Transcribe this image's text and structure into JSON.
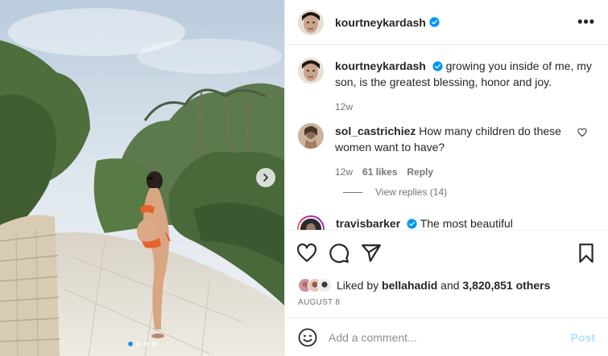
{
  "post": {
    "username": "kourtneykardash",
    "more_label": "•••",
    "caption": {
      "username": "kourtneykardash",
      "text": "growing you inside of me, my son, is the greatest blessing, honor and joy.",
      "age": "12w"
    },
    "comments": [
      {
        "username": "sol_castrichiez",
        "text": "How many children do these women want to have?",
        "age": "12w",
        "likes": "61 likes",
        "reply_label": "Reply",
        "view_replies": "View replies (14)"
      },
      {
        "username": "travisbarker",
        "text": "The most beautiful"
      }
    ],
    "liked_by_prefix": "Liked by",
    "liked_by_user": "bellahadid",
    "liked_by_and": "and",
    "liked_by_others": "3,820,851 others",
    "date": "AUGUST 8",
    "add_comment_placeholder": "Add a comment...",
    "post_label": "Post"
  },
  "colors": {
    "verified": "#0095f6",
    "post_button_disabled": "#b2dffc",
    "carousel_active_dot": "#1e90ff"
  },
  "icons": [
    "verified-badge-icon",
    "heart-icon",
    "comment-icon",
    "share-icon",
    "bookmark-icon",
    "emoji-icon",
    "chevron-right-icon",
    "more-options-icon"
  ]
}
